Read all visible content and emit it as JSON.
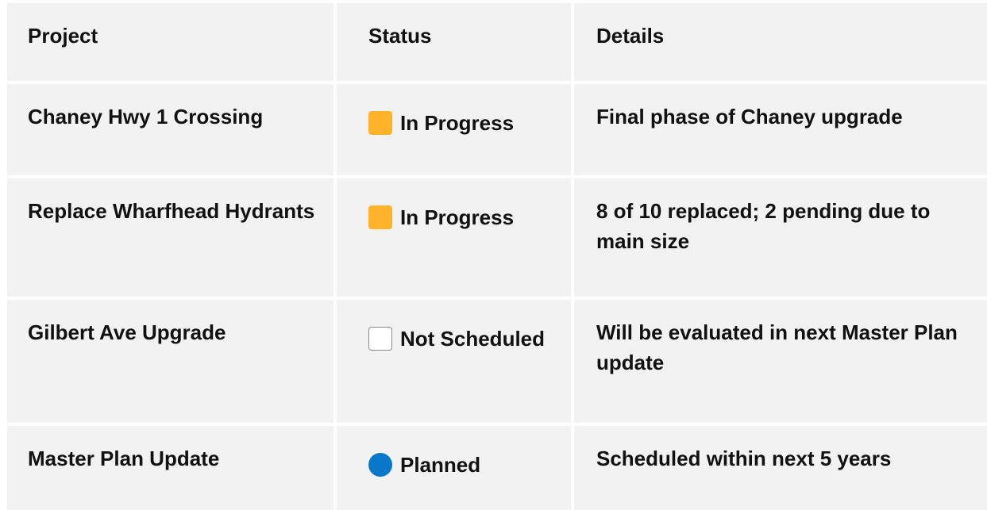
{
  "headers": {
    "project": "Project",
    "status": "Status",
    "details": "Details"
  },
  "rows": [
    {
      "project": "Chaney Hwy 1 Crossing",
      "status_label": "In Progress",
      "status_icon": "orange-square-icon",
      "status_color": "#FFB32A",
      "details": "Final phase of Chaney upgrade"
    },
    {
      "project": "Replace Wharfhead Hydrants",
      "status_label": "In Progress",
      "status_icon": "orange-square-icon",
      "status_color": "#FFB32A",
      "details": "8 of 10 replaced; 2 pending due to main size"
    },
    {
      "project": "Gilbert Ave Upgrade",
      "status_label": "Not Scheduled",
      "status_icon": "empty-square-icon",
      "status_color": "#FFFFFF",
      "details": "Will be evaluated in next Master Plan update"
    },
    {
      "project": "Master Plan Update",
      "status_label": "Planned",
      "status_icon": "blue-circle-icon",
      "status_color": "#0A78C8",
      "details": "Scheduled within next 5 years"
    }
  ]
}
